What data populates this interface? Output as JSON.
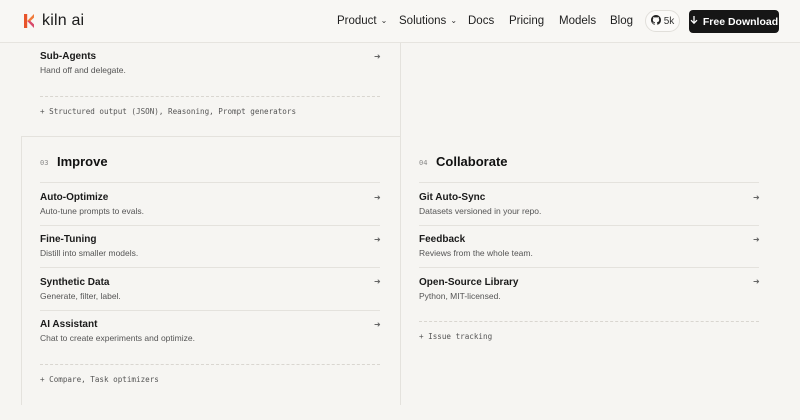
{
  "brand": {
    "name": "kiln ai",
    "accent": "#e8542a"
  },
  "nav": {
    "product": "Product",
    "solutions": "Solutions",
    "docs": "Docs",
    "pricing": "Pricing",
    "models": "Models",
    "blog": "Blog",
    "github_stars": "5k",
    "download_label": "Free Download"
  },
  "top_section": {
    "item": {
      "title": "Sub-Agents",
      "desc": "Hand off and delegate."
    },
    "footnote": "+ Structured output (JSON), Reasoning, Prompt generators"
  },
  "improve": {
    "number": "03",
    "title": "Improve",
    "items": [
      {
        "title": "Auto-Optimize",
        "desc": "Auto-tune prompts to evals."
      },
      {
        "title": "Fine-Tuning",
        "desc": "Distill into smaller models."
      },
      {
        "title": "Synthetic Data",
        "desc": "Generate, filter, label."
      },
      {
        "title": "AI Assistant",
        "desc": "Chat to create experiments and optimize."
      }
    ],
    "footnote": "+ Compare, Task optimizers"
  },
  "collaborate": {
    "number": "04",
    "title": "Collaborate",
    "items": [
      {
        "title": "Git Auto-Sync",
        "desc": "Datasets versioned in your repo."
      },
      {
        "title": "Feedback",
        "desc": "Reviews from the whole team."
      },
      {
        "title": "Open-Source Library",
        "desc": "Python, MIT-licensed."
      }
    ],
    "footnote": "+ Issue tracking"
  },
  "icons": {
    "arrow": "arrow-right-icon",
    "chevron": "chevron-down-icon",
    "github": "github-icon",
    "download": "download-icon"
  }
}
